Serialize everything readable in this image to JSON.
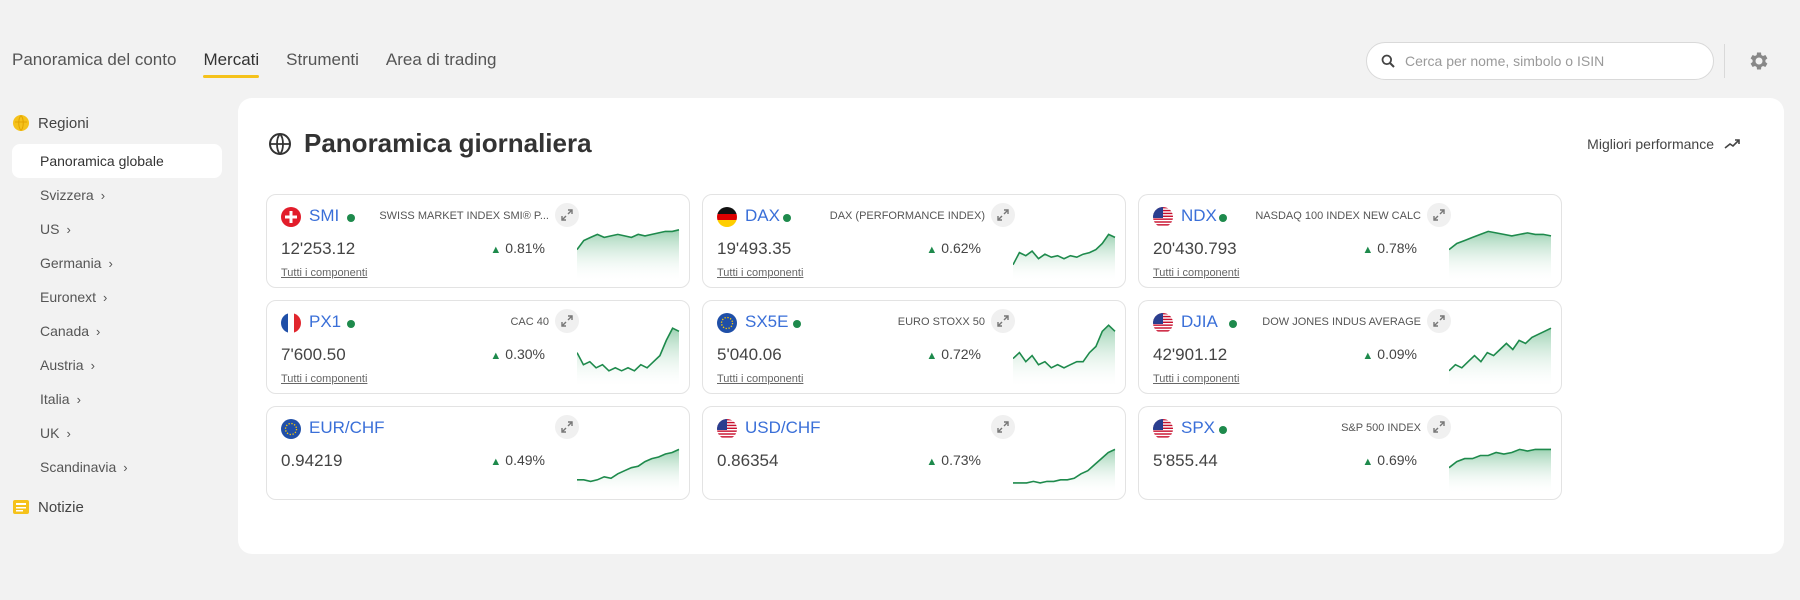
{
  "nav": {
    "tabs": [
      {
        "label": "Panoramica del conto",
        "active": false
      },
      {
        "label": "Mercati",
        "active": true
      },
      {
        "label": "Strumenti",
        "active": false
      },
      {
        "label": "Area di trading",
        "active": false
      }
    ],
    "search_placeholder": "Cerca per nome, simbolo o ISIN",
    "settings_icon": "gear-icon"
  },
  "sidebar": {
    "regions_label": "Regioni",
    "items": [
      {
        "label": "Panoramica globale",
        "active": true,
        "has_chevron": false
      },
      {
        "label": "Svizzera",
        "has_chevron": true
      },
      {
        "label": "US",
        "has_chevron": true
      },
      {
        "label": "Germania",
        "has_chevron": true
      },
      {
        "label": "Euronext",
        "has_chevron": true
      },
      {
        "label": "Canada",
        "has_chevron": true
      },
      {
        "label": "Austria",
        "has_chevron": true
      },
      {
        "label": "Italia",
        "has_chevron": true
      },
      {
        "label": "UK",
        "has_chevron": true
      },
      {
        "label": "Scandinavia",
        "has_chevron": true
      }
    ],
    "news_label": "Notizie",
    "chevron": "›"
  },
  "main": {
    "title": "Panoramica giornaliera",
    "top_performers_label": "Migliori performance",
    "components_label": "Tutti i componenti",
    "cards": [
      {
        "symbol": "SMI",
        "flag": "ch",
        "live": true,
        "name": "SWISS MARKET INDEX SMI® P...",
        "price": "12'253.12",
        "change": "0.81%",
        "components": true,
        "spark": [
          30,
          24,
          22,
          20,
          22,
          21,
          20,
          21,
          22,
          20,
          21,
          20,
          19,
          18,
          18,
          17
        ]
      },
      {
        "symbol": "DAX",
        "flag": "de",
        "live": true,
        "name": "DAX (PERFORMANCE INDEX)",
        "price": "19'493.35",
        "change": "0.62%",
        "components": true,
        "spark": [
          40,
          32,
          34,
          31,
          36,
          33,
          35,
          34,
          36,
          34,
          35,
          33,
          32,
          30,
          26,
          20,
          22
        ]
      },
      {
        "symbol": "NDX",
        "flag": "us",
        "live": true,
        "name": "NASDAQ 100 INDEX NEW CALC",
        "price": "20'430.793",
        "change": "0.78%",
        "components": true,
        "spark": [
          30,
          26,
          24,
          22,
          20,
          18,
          19,
          20,
          21,
          20,
          19,
          20,
          20,
          21
        ]
      },
      {
        "symbol": "PX1",
        "flag": "fr",
        "live": true,
        "name": "CAC 40",
        "price": "7'600.50",
        "change": "0.30%",
        "components": true,
        "spark": [
          28,
          36,
          34,
          38,
          36,
          40,
          38,
          40,
          38,
          40,
          36,
          38,
          34,
          30,
          20,
          12,
          14
        ]
      },
      {
        "symbol": "SX5E",
        "flag": "eu",
        "live": true,
        "name": "EURO STOXX 50",
        "price": "5'040.06",
        "change": "0.72%",
        "components": true,
        "spark": [
          32,
          28,
          34,
          30,
          36,
          34,
          38,
          36,
          38,
          36,
          34,
          34,
          28,
          24,
          14,
          10,
          14
        ]
      },
      {
        "symbol": "DJIA",
        "flag": "us",
        "live": true,
        "name": "DOW JONES INDUS AVERAGE",
        "price": "42'901.12",
        "change": "0.09%",
        "components": true,
        "spark": [
          40,
          36,
          38,
          34,
          30,
          34,
          28,
          30,
          26,
          22,
          26,
          20,
          22,
          18,
          16,
          14,
          12
        ]
      },
      {
        "symbol": "EUR/CHF",
        "flag": "eu",
        "live": false,
        "name": "",
        "price": "0.94219",
        "change": "0.49%",
        "components": false,
        "spark": [
          42,
          42,
          43,
          42,
          40,
          41,
          38,
          36,
          34,
          33,
          30,
          28,
          27,
          25,
          24,
          22
        ]
      },
      {
        "symbol": "USD/CHF",
        "flag": "us",
        "live": false,
        "name": "",
        "price": "0.86354",
        "change": "0.73%",
        "components": false,
        "spark": [
          44,
          44,
          44,
          43,
          44,
          43,
          43,
          42,
          42,
          41,
          38,
          36,
          32,
          28,
          24,
          22
        ]
      },
      {
        "symbol": "SPX",
        "flag": "ch_us",
        "live": true,
        "name": "S&P 500 INDEX",
        "price": "5'855.44",
        "change": "0.69%",
        "components": false,
        "spark": [
          34,
          30,
          28,
          28,
          26,
          26,
          24,
          25,
          24,
          22,
          23,
          22,
          22,
          22
        ]
      }
    ]
  },
  "colors": {
    "accent": "#f5c21b",
    "link": "#3a6fd8",
    "positive": "#1e8a4c",
    "spark_fill": "#cfe9d9"
  }
}
